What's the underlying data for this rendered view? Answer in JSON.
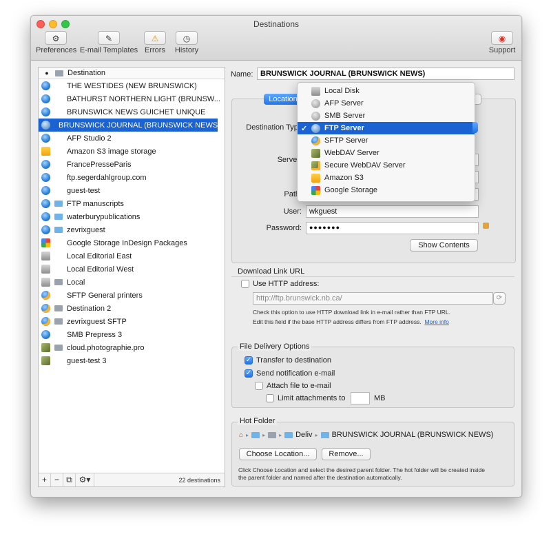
{
  "window": {
    "title": "Destinations"
  },
  "toolbar": {
    "preferences": "Preferences",
    "email_templates": "E-mail Templates",
    "errors": "Errors",
    "history": "History",
    "support": "Support"
  },
  "sidebar": {
    "header_label": "Destination",
    "items": [
      {
        "label": " THE WESTIDES  (NEW BRUNSWICK)",
        "icon": "globe-icon"
      },
      {
        "label": "BATHURST NORTHERN LIGHT (BRUNSW...",
        "icon": "globe-icon"
      },
      {
        "label": "BRUNSWICK NEWS GUICHET UNIQUE",
        "icon": "globe-icon"
      },
      {
        "label": "BRUNSWICK JOURNAL (BRUNSWICK NEWS)",
        "icon": "ftp-icon"
      },
      {
        "label": "AFP Studio 2",
        "icon": "globe-icon"
      },
      {
        "label": "Amazon S3 image storage",
        "icon": "amazon-s3-icon"
      },
      {
        "label": "FrancePresseParis",
        "icon": "globe-icon"
      },
      {
        "label": "ftp.segerdahlgroup.com",
        "icon": "globe-icon"
      },
      {
        "label": "guest-test",
        "icon": "globe-icon"
      },
      {
        "label": "FTP manuscripts",
        "icon": "globe-icon"
      },
      {
        "label": "waterburypublications",
        "icon": "globe-icon"
      },
      {
        "label": "zevrixguest",
        "icon": "globe-icon"
      },
      {
        "label": "Google Storage InDesign Packages",
        "icon": "google-icon"
      },
      {
        "label": "Local Editorial East",
        "icon": "disk-icon"
      },
      {
        "label": "Local Editorial West",
        "icon": "disk-icon"
      },
      {
        "label": "Local",
        "icon": "disk-icon"
      },
      {
        "label": "SFTP General printers",
        "icon": "sftp-icon"
      },
      {
        "label": "Destination 2",
        "icon": "sftp-icon"
      },
      {
        "label": "zevrixguest SFTP",
        "icon": "sftp-icon"
      },
      {
        "label": "SMB Prepress 3",
        "icon": "globe-icon"
      },
      {
        "label": "cloud.photographie.pro",
        "icon": "webdav-icon"
      },
      {
        "label": "guest-test 3",
        "icon": "webdav-icon"
      }
    ],
    "footer": {
      "add": "+",
      "remove": "−",
      "duplicate": "⧉",
      "actions": "⚙▾",
      "count": "22 destinations"
    }
  },
  "form": {
    "name_label": "Name:",
    "name_value": "BRUNSWICK JOURNAL (BRUNSWICK NEWS)",
    "tab_location": "Location",
    "dest_type_label": "Destination Type",
    "server_label": "Server",
    "path_label": "Path",
    "user_label": "User:",
    "user_value": "wkguest",
    "password_label": "Password:",
    "password_value": "●●●●●●●",
    "show_contents": "Show Contents",
    "download_link_title": "Download Link URL",
    "use_http_label": "Use HTTP address:",
    "http_placeholder": "http://ftp.brunswick.nb.ca/",
    "hint_line1": "Check this option to use HTTP download link in e-mail rather than FTP URL.",
    "hint_line2": "Edit this field if the base HTTP address differs from FTP address.",
    "more_info": "More info"
  },
  "dropdown": {
    "items": [
      {
        "label": "Local Disk",
        "icon": "disk-icon"
      },
      {
        "label": "AFP Server",
        "icon": "afp-icon"
      },
      {
        "label": "SMB Server",
        "icon": "smb-icon"
      },
      {
        "label": "FTP Server",
        "icon": "ftp-icon"
      },
      {
        "label": "SFTP Server",
        "icon": "sftp-icon"
      },
      {
        "label": "WebDAV Server",
        "icon": "webdav-icon"
      },
      {
        "label": "Secure WebDAV Server",
        "icon": "secure-webdav-icon"
      },
      {
        "label": "Amazon S3",
        "icon": "amazon-s3-icon"
      },
      {
        "label": "Google Storage",
        "icon": "google-icon"
      }
    ],
    "selected": "FTP Server",
    "check": "✓"
  },
  "delivery": {
    "title": "File Delivery Options",
    "transfer": "Transfer to destination",
    "notify": "Send notification e-mail",
    "attach": "Attach file to e-mail",
    "limit": "Limit attachments to",
    "limit_unit": "MB"
  },
  "hotfolder": {
    "title": "Hot Folder",
    "path_short": "Deliv",
    "path_end": "BRUNSWICK JOURNAL (BRUNSWICK NEWS)",
    "choose": "Choose Location...",
    "remove": "Remove...",
    "hint_line1": "Click Choose Location and select the desired parent folder. The hot folder will be created inside",
    "hint_line2": "the parent folder and named after the destination automatically."
  },
  "colors": {
    "selection": "#1b63d3",
    "accent": "#2275e8"
  }
}
